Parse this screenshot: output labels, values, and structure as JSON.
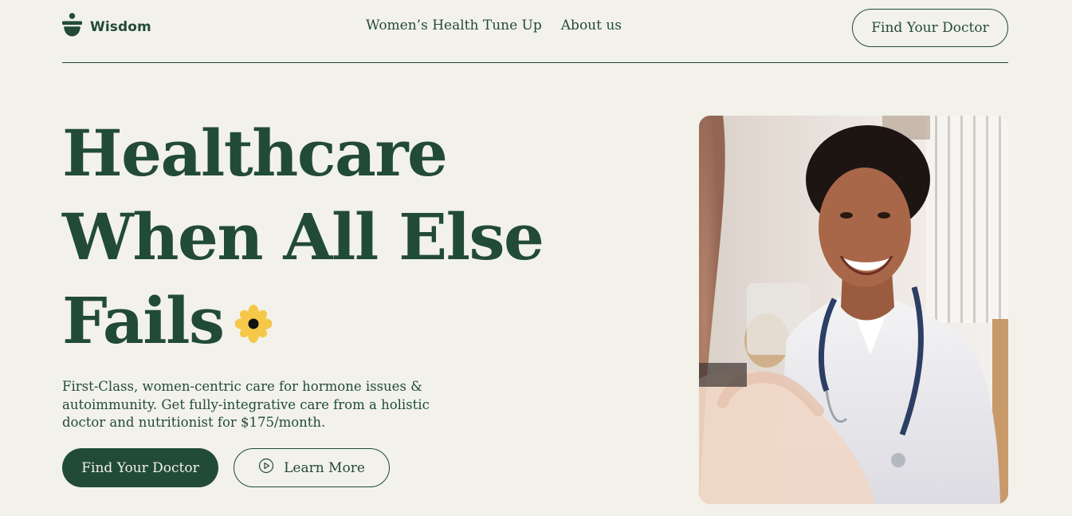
{
  "header": {
    "brand_name": "Wisdom",
    "nav": [
      {
        "label": "Women’s Health Tune Up"
      },
      {
        "label": "About us"
      }
    ],
    "cta_label": "Find Your Doctor"
  },
  "hero": {
    "title_lines": [
      "Healthcare",
      "When All Else",
      "Fails"
    ],
    "flower_icon": "flower-icon",
    "description": "First-Class, women-centric care for hormone issues & autoimmunity. Get fully-integrative care from a holistic doctor and nutritionist for $175/month.",
    "primary_button": "Find Your Doctor",
    "secondary_button": "Learn More",
    "secondary_icon": "play-circle-icon",
    "photo_icon": "doctor-photo"
  },
  "colors": {
    "background": "#f2f2ea",
    "primary": "#224b35",
    "flower_petals": "#f5c84a",
    "flower_center": "#111111"
  }
}
